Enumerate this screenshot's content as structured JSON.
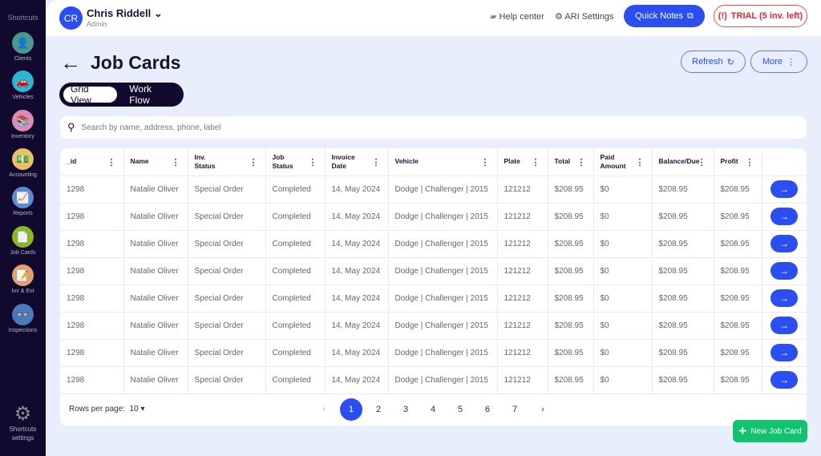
{
  "sidebar": {
    "title": "Shortcuts",
    "items": [
      {
        "label": "Clients",
        "icon": "client-icon",
        "bg": "#4a9a8c",
        "glyph": "👤"
      },
      {
        "label": "Vehicles",
        "icon": "vehicles-icon",
        "bg": "#29b6d0",
        "glyph": "🚗"
      },
      {
        "label": "Inventory",
        "icon": "inventory-icon",
        "bg": "#d98cb8",
        "glyph": "📚"
      },
      {
        "label": "Accounting",
        "icon": "accounting-icon",
        "bg": "#e8c06a",
        "glyph": "💵"
      },
      {
        "label": "Reports",
        "icon": "reports-icon",
        "bg": "#5b8bd0",
        "glyph": "📈"
      },
      {
        "label": "Job Cards",
        "icon": "job-cards-icon",
        "bg": "#8bb820",
        "glyph": "📄"
      },
      {
        "label": "Inv & Est",
        "icon": "inv-est-icon",
        "bg": "#e0a070",
        "glyph": "📝"
      },
      {
        "label": "Inspections",
        "icon": "inspections-icon",
        "bg": "#4a78b8",
        "glyph": "👓"
      }
    ],
    "settings_line1": "Shortcuts",
    "settings_line2": "settings"
  },
  "user": {
    "initials": "CR",
    "name": "Chris Riddell",
    "role": "Admin"
  },
  "topbar": {
    "help": "Help center",
    "settings": "ARI Settings",
    "quick_notes": "Quick Notes",
    "trial": "TRIAL (5 inv. left)"
  },
  "page": {
    "title": "Job Cards",
    "refresh": "Refresh",
    "more": "More",
    "views": [
      "Grid View",
      "Work Flow"
    ],
    "search_placeholder": "Search by name, address, phone, label"
  },
  "table": {
    "columns": [
      "_id",
      "Name",
      "Inv. Status",
      "Job Status",
      "Invoice Date",
      "Vehicle",
      "Plate",
      "Total",
      "Paid Amount",
      "Balance/Due",
      "Profit",
      ""
    ],
    "rows": [
      [
        "1298",
        "Natalie Oliver",
        "Special Order",
        "Completed",
        "14, May 2024",
        "Dodge | Challenger | 2015",
        "121212",
        "$208.95",
        "$0",
        "$208.95",
        "$208.95"
      ],
      [
        "1298",
        "Natalie Oliver",
        "Special Order",
        "Completed",
        "14, May 2024",
        "Dodge | Challenger | 2015",
        "121212",
        "$208.95",
        "$0",
        "$208.95",
        "$208.95"
      ],
      [
        "1298",
        "Natalie Oliver",
        "Special Order",
        "Completed",
        "14, May 2024",
        "Dodge | Challenger | 2015",
        "121212",
        "$208.95",
        "$0",
        "$208.95",
        "$208.95"
      ],
      [
        "1298",
        "Natalie Oliver",
        "Special Order",
        "Completed",
        "14, May 2024",
        "Dodge | Challenger | 2015",
        "121212",
        "$208.95",
        "$0",
        "$208.95",
        "$208.95"
      ],
      [
        "1298",
        "Natalie Oliver",
        "Special Order",
        "Completed",
        "14, May 2024",
        "Dodge | Challenger | 2015",
        "121212",
        "$208.95",
        "$0",
        "$208.95",
        "$208.95"
      ],
      [
        "1298",
        "Natalie Oliver",
        "Special Order",
        "Completed",
        "14, May 2024",
        "Dodge | Challenger | 2015",
        "121212",
        "$208.95",
        "$0",
        "$208.95",
        "$208.95"
      ],
      [
        "1298",
        "Natalie Oliver",
        "Special Order",
        "Completed",
        "14, May 2024",
        "Dodge | Challenger | 2015",
        "121212",
        "$208.95",
        "$0",
        "$208.95",
        "$208.95"
      ],
      [
        "1298",
        "Natalie Oliver",
        "Special Order",
        "Completed",
        "14, May 2024",
        "Dodge | Challenger | 2015",
        "121212",
        "$208.95",
        "$0",
        "$208.95",
        "$208.95"
      ]
    ]
  },
  "pagination": {
    "rows_label": "Rows per page:",
    "rows_value": "10",
    "pages": [
      "1",
      "2",
      "3",
      "4",
      "5",
      "6",
      "7"
    ],
    "current": "1"
  },
  "new_job_card": "New Job Card",
  "colors": {
    "accent": "#2a4ef0",
    "sidebar": "#120a2e",
    "success": "#13c26e",
    "danger": "#e8262a"
  }
}
